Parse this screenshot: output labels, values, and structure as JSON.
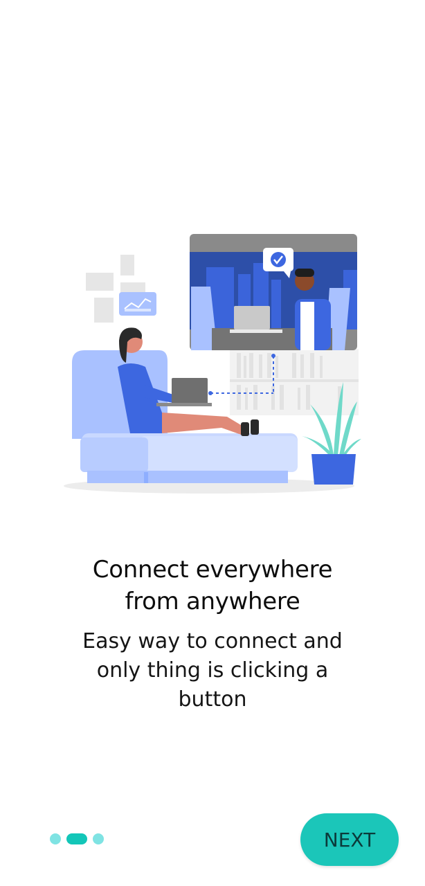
{
  "onboarding": {
    "title_lines": [
      "Connect everywhere",
      "from anywhere"
    ],
    "subtitle_lines": [
      "Easy way to connect and",
      "only thing is clicking a",
      "button"
    ],
    "pager": {
      "count": 3,
      "active_index": 1
    },
    "next_label": "NEXT",
    "illustration_icon": "video-call-illustration"
  },
  "colors": {
    "accent": "#1bc6b9",
    "dot_inactive": "#7fe3e3",
    "dot_active": "#13c6b8",
    "illustration_blue": "#3d67e0",
    "illustration_light_blue": "#a9c1ff"
  }
}
